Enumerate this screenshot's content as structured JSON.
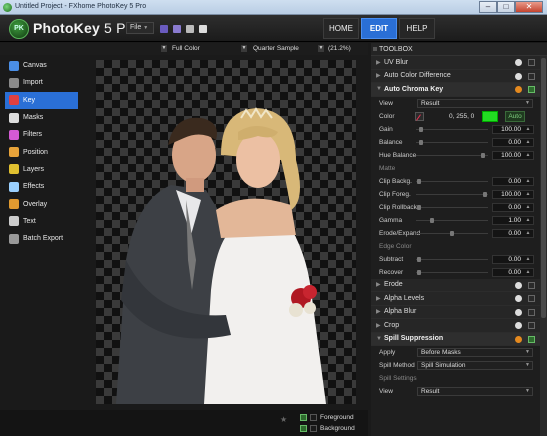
{
  "window": {
    "title": "Untitled Project - FXhome PhotoKey 5 Pro",
    "min": "–",
    "max": "□",
    "close": "✕"
  },
  "header": {
    "logo_text": "PK",
    "brand_name": "PhotoKey",
    "brand_version": " 5 Pro",
    "file_menu": "File",
    "nav": {
      "home": "HOME",
      "edit": "EDIT",
      "help": "HELP"
    }
  },
  "options": {
    "color_mode": "Full Color",
    "sample": "Quarter Sample",
    "zoom": "(21.2%)"
  },
  "sidebar": {
    "items": [
      {
        "label": "Canvas",
        "icon": "canvas-icon",
        "color": "#4a8ee6"
      },
      {
        "label": "Import",
        "icon": "import-icon",
        "color": "#8a8a8a"
      },
      {
        "label": "Key",
        "icon": "key-icon",
        "color": "#e04040"
      },
      {
        "label": "Masks",
        "icon": "masks-icon",
        "color": "#dddddd"
      },
      {
        "label": "Filters",
        "icon": "filters-icon",
        "color": "#d45ad4"
      },
      {
        "label": "Position",
        "icon": "position-icon",
        "color": "#e8a33a"
      },
      {
        "label": "Layers",
        "icon": "layers-icon",
        "color": "#e0c030"
      },
      {
        "label": "Effects",
        "icon": "effects-icon",
        "color": "#9ad0ff"
      },
      {
        "label": "Overlay",
        "icon": "overlay-icon",
        "color": "#e09a30"
      },
      {
        "label": "Text",
        "icon": "text-icon",
        "color": "#cccccc"
      },
      {
        "label": "Batch Export",
        "icon": "batch-export-icon",
        "color": "#999999"
      }
    ],
    "active_index": 2
  },
  "bottombar": {
    "foreground": "Foreground",
    "background": "Background"
  },
  "toolbox": {
    "title": "TOOLBOX",
    "effects_top": [
      {
        "label": "UV Blur"
      },
      {
        "label": "Auto Color Difference"
      }
    ],
    "chroma": {
      "title": "Auto Chroma Key",
      "view_label": "View",
      "view_value": "Result",
      "color_label": "Color",
      "color_value": "0, 255, 0",
      "auto_label": "Auto",
      "swatch": "#22dd22",
      "params": [
        {
          "label": "Gain",
          "value": "100.00",
          "knob": 0.05
        },
        {
          "label": "Balance",
          "value": "0.00",
          "knob": 0.05
        },
        {
          "label": "Hue Balance",
          "value": "100.00",
          "knob": 0.95
        }
      ],
      "matte_title": "Matte",
      "matte": [
        {
          "label": "Clip Backg.",
          "value": "0.00",
          "knob": 0.02
        },
        {
          "label": "Clip Foreg.",
          "value": "100.00",
          "knob": 0.98
        },
        {
          "label": "Clip Rollback",
          "value": "0.00",
          "knob": 0.02
        },
        {
          "label": "Gamma",
          "value": "1.00",
          "knob": 0.2
        },
        {
          "label": "Erode/Expand",
          "value": "0.00",
          "knob": 0.5
        }
      ],
      "edge_title": "Edge Color",
      "edge": [
        {
          "label": "Subtract",
          "value": "0.00",
          "knob": 0.02
        },
        {
          "label": "Recover",
          "value": "0.00",
          "knob": 0.02
        }
      ]
    },
    "effects_mid": [
      {
        "label": "Erode"
      },
      {
        "label": "Alpha Levels"
      },
      {
        "label": "Alpha Blur"
      },
      {
        "label": "Crop"
      }
    ],
    "spill": {
      "title": "Spill Suppression",
      "apply_label": "Apply",
      "apply_value": "Before Masks",
      "method_label": "Spill Method",
      "method_value": "Spill Simulation",
      "settings_title": "Spill Settings",
      "view_label": "View",
      "view_value": "Result"
    }
  }
}
